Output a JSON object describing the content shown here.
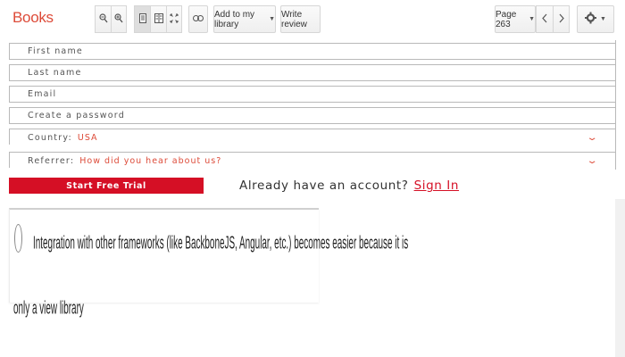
{
  "toolbar": {
    "brand": "Books",
    "add_to_library": "Add to my library",
    "write_review": "Write review",
    "page_label": "Page 263"
  },
  "form": {
    "first_name_placeholder": "First name",
    "last_name_placeholder": "Last name",
    "email_placeholder": "Email",
    "password_placeholder": "Create a password",
    "country_label": "Country:",
    "country_value": "USA",
    "referrer_label": "Referrer:",
    "referrer_value": "How did you hear about us?",
    "cta_label": "Start Free Trial",
    "already_text": "Already have an account?",
    "signin_label": "Sign In"
  },
  "answer": {
    "line1": "Integration with other frameworks (like BackboneJS, Angular, etc.) becomes easier because it is",
    "line2": "only a view library"
  },
  "colors": {
    "brand": "#dd4b39",
    "accent": "#d50f25"
  }
}
